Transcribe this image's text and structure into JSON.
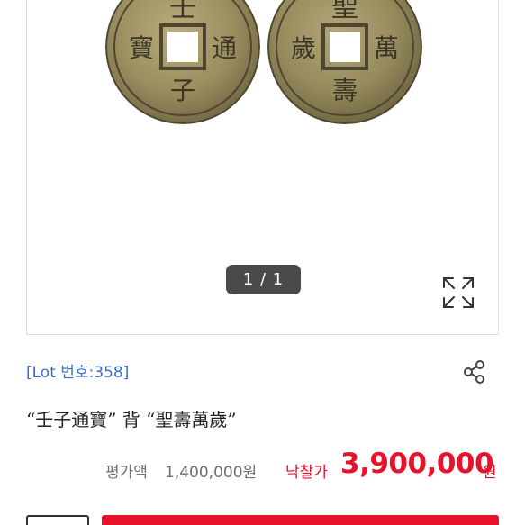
{
  "gallery": {
    "counter": "1 / 1",
    "front_coin_chars": [
      "壬",
      "通",
      "子",
      "寶"
    ],
    "back_coin_chars": [
      "聖",
      "萬",
      "壽",
      "歲"
    ]
  },
  "lot": {
    "number_label": "[Lot 번호:358]",
    "title": "“壬子通寶” 背 “聖壽萬歲”"
  },
  "price": {
    "estimate_label": "평가액",
    "estimate_value": "1,400,000원",
    "winning_label": "낙찰가",
    "winning_value": "3,900,000",
    "winning_unit": "원"
  },
  "icons": {
    "expand": "expand-icon",
    "share": "share-icon"
  },
  "colors": {
    "accent_red": "#e8122b",
    "link_blue": "#3b6fc6",
    "coin_bronze": "#8f8556"
  }
}
